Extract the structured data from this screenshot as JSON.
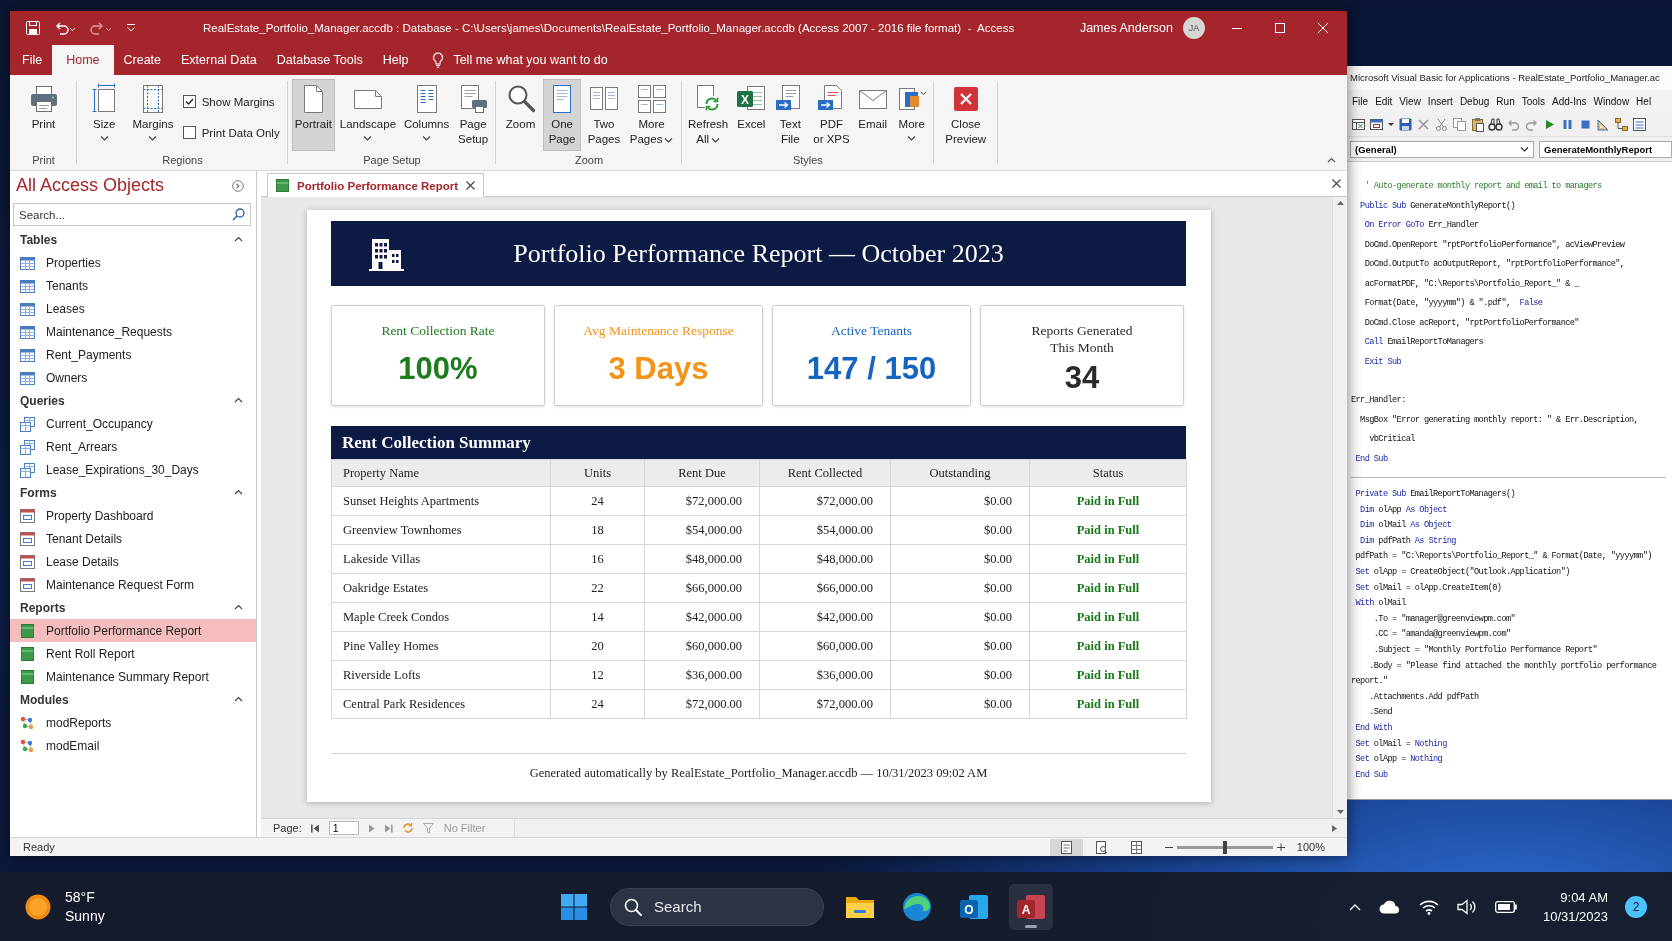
{
  "window": {
    "title": "RealEstate_Portfolio_Manager.accdb : Database - C:\\Users\\james\\Documents\\RealEstate_Portfolio_Manager.accdb (Access 2007 - 2016 file format)  -  Access",
    "user": "James Anderson",
    "initials": "JA"
  },
  "ribbon": {
    "tabs": [
      {
        "label": "File",
        "selected": false
      },
      {
        "label": "Home",
        "selected": true
      },
      {
        "label": "Create",
        "selected": false
      },
      {
        "label": "External Data",
        "selected": false
      },
      {
        "label": "Database Tools",
        "selected": false
      },
      {
        "label": "Help",
        "selected": false
      }
    ],
    "tell_me": "Tell me what you want to do",
    "groups": [
      {
        "label": "Print",
        "items": [
          {
            "kind": "large",
            "label": "Print",
            "dropdown": false,
            "selected": false
          }
        ]
      },
      {
        "label": "Regions",
        "items": [
          {
            "kind": "large",
            "label": "Size",
            "dropdown": true,
            "selected": false
          },
          {
            "kind": "large",
            "label": "Margins",
            "dropdown": true,
            "selected": false
          },
          {
            "kind": "checkbox_stack",
            "options": [
              {
                "label": "Show Margins",
                "checked": true
              },
              {
                "label": "Print Data Only",
                "checked": false
              }
            ]
          }
        ]
      },
      {
        "label": "Page Setup",
        "items": [
          {
            "kind": "large",
            "label": "Portrait",
            "dropdown": false,
            "selected": true
          },
          {
            "kind": "large",
            "label": "Landscape",
            "dropdown": true,
            "selected": false
          },
          {
            "kind": "large",
            "label": "Columns",
            "dropdown": true,
            "selected": false
          },
          {
            "kind": "large",
            "label": "Page\nSetup",
            "dropdown": false,
            "selected": false
          }
        ]
      },
      {
        "label": "Zoom",
        "items": [
          {
            "kind": "large",
            "label": "Zoom",
            "dropdown": false,
            "selected": false
          },
          {
            "kind": "large",
            "label": "One\nPage",
            "dropdown": false,
            "selected": true
          },
          {
            "kind": "large",
            "label": "Two\nPages",
            "dropdown": false,
            "selected": false
          },
          {
            "kind": "large",
            "label": "More\nPages",
            "dropdown": true,
            "selected": false
          }
        ]
      },
      {
        "label": "Styles",
        "items": [
          {
            "kind": "large",
            "label": "Refresh\nAll",
            "dropdown": true,
            "selected": false
          },
          {
            "kind": "large",
            "label": "Excel",
            "letter": "X",
            "dropdown": false,
            "selected": false
          },
          {
            "kind": "large",
            "label": "Text\nFile",
            "dropdown": false,
            "selected": false
          },
          {
            "kind": "large",
            "label": "PDF\nor XPS",
            "dropdown": false,
            "selected": false
          },
          {
            "kind": "large",
            "label": "Email",
            "dropdown": false,
            "selected": false
          },
          {
            "kind": "large",
            "label": "More",
            "dropdown": true,
            "selected": false
          }
        ]
      },
      {
        "items": [
          {
            "kind": "large",
            "label": "Close\nPreview",
            "dropdown": false,
            "selected": false
          }
        ]
      }
    ]
  },
  "nav_pane": {
    "title": "All Access Objects",
    "search": {
      "placeholder": "Search..."
    },
    "sections": [
      {
        "label": "Tables",
        "kind": "table",
        "expanded": true,
        "items": [
          {
            "label": "Properties",
            "selected": false
          },
          {
            "label": "Tenants",
            "selected": false
          },
          {
            "label": "Leases",
            "selected": false
          },
          {
            "label": "Maintenance_Requests",
            "selected": false
          },
          {
            "label": "Rent_Payments",
            "selected": false
          },
          {
            "label": "Owners",
            "selected": false
          }
        ]
      },
      {
        "label": "Queries",
        "kind": "query",
        "expanded": true,
        "items": [
          {
            "label": "Current_Occupancy",
            "selected": false
          },
          {
            "label": "Rent_Arrears",
            "selected": false
          },
          {
            "label": "Lease_Expirations_30_Days",
            "selected": false
          }
        ]
      },
      {
        "label": "Forms",
        "kind": "form",
        "expanded": true,
        "items": [
          {
            "label": "Property Dashboard",
            "selected": false
          },
          {
            "label": "Tenant Details",
            "selected": false
          },
          {
            "label": "Lease Details",
            "selected": false
          },
          {
            "label": "Maintenance Request Form",
            "selected": false
          }
        ]
      },
      {
        "label": "Reports",
        "kind": "report",
        "expanded": true,
        "items": [
          {
            "label": "Portfolio Performance Report",
            "selected": true
          },
          {
            "label": "Rent Roll Report",
            "selected": false
          },
          {
            "label": "Maintenance Summary Report",
            "selected": false
          }
        ]
      },
      {
        "label": "Modules",
        "kind": "module",
        "expanded": true,
        "items": [
          {
            "label": "modReports",
            "selected": false
          },
          {
            "label": "modEmail",
            "selected": false
          }
        ]
      }
    ]
  },
  "document_tabs": [
    {
      "label": "Portfolio Performance Report",
      "selected": true
    }
  ],
  "report": {
    "title": "Portfolio Performance Report — October 2023",
    "kpis": [
      {
        "label": "Rent Collection Rate",
        "value": "100%",
        "color": "#1e7b1e"
      },
      {
        "label": "Avg Maintenance Response",
        "value": "3 Days",
        "color": "#f39317"
      },
      {
        "label": "Active Tenants",
        "value": "147 / 150",
        "color": "#1565c0"
      },
      {
        "label": "Reports Generated\nThis Month",
        "value": "34",
        "color": "#2a2a2a"
      }
    ],
    "summary": {
      "title": "Rent Collection Summary",
      "columns": [
        "Property Name",
        "Units",
        "Rent Due",
        "Rent Collected",
        "Outstanding",
        "Status"
      ],
      "rows": [
        [
          "Sunset Heights Apartments",
          "24",
          "$72,000.00",
          "$72,000.00",
          "$0.00",
          "Paid in Full"
        ],
        [
          "Greenview Townhomes",
          "18",
          "$54,000.00",
          "$54,000.00",
          "$0.00",
          "Paid in Full"
        ],
        [
          "Lakeside Villas",
          "16",
          "$48,000.00",
          "$48,000.00",
          "$0.00",
          "Paid in Full"
        ],
        [
          "Oakridge Estates",
          "22",
          "$66,000.00",
          "$66,000.00",
          "$0.00",
          "Paid in Full"
        ],
        [
          "Maple Creek Condos",
          "14",
          "$42,000.00",
          "$42,000.00",
          "$0.00",
          "Paid in Full"
        ],
        [
          "Pine Valley Homes",
          "20",
          "$60,000.00",
          "$60,000.00",
          "$0.00",
          "Paid in Full"
        ],
        [
          "Riverside Lofts",
          "12",
          "$36,000.00",
          "$36,000.00",
          "$0.00",
          "Paid in Full"
        ],
        [
          "Central Park Residences",
          "24",
          "$72,000.00",
          "$72,000.00",
          "$0.00",
          "Paid in Full"
        ]
      ]
    },
    "footer": "Generated automatically by RealEstate_Portfolio_Manager.accdb — 10/31/2023 09:02 AM"
  },
  "record_nav": {
    "label": "Page:",
    "value": "1",
    "filter": "No Filter"
  },
  "status_bar": {
    "text": "Ready",
    "views": [
      {
        "selected": true
      },
      {
        "selected": false
      },
      {
        "selected": false
      }
    ],
    "zoom": {
      "level": 0.5
    },
    "zoom_text": "100%"
  },
  "vba": {
    "title": "Microsoft Visual Basic for Applications - RealEstate_Portfolio_Manager.ac",
    "menu": [
      "File",
      "Edit",
      "View",
      "Insert",
      "Debug",
      "Run",
      "Tools",
      "Add-Ins",
      "Window",
      "Hel"
    ],
    "object_box": "(General)",
    "procedure_box": "GenerateMonthlyReport",
    "procedures": [
      {
        "blocks": [
          {
            "lines": [
              [
                {
                  "kind": "comment",
                  "text": "   ' Auto-generate monthly report and email to managers"
                }
              ],
              [
                {
                  "kind": "keyword",
                  "text": "  Public Sub"
                },
                {
                  "kind": "plain",
                  "text": " GenerateMonthlyReport()"
                }
              ],
              [
                {
                  "kind": "keyword",
                  "text": "   On Error GoTo"
                },
                {
                  "kind": "plain",
                  "text": " Err_Handler"
                }
              ],
              [
                {
                  "kind": "plain",
                  "text": "   DoCmd.OpenReport \"rptPortfolioPerformance\", acViewPreview"
                }
              ],
              [
                {
                  "kind": "plain",
                  "text": "   DoCmd.OutputTo acOutputReport, \"rptPortfolioPerformance\","
                }
              ],
              [
                {
                  "kind": "plain",
                  "text": "   acFormatPDF, \"C:\\Reports\\Portfolio_Report_\" & _"
                }
              ],
              [
                {
                  "kind": "plain",
                  "text": "   Format(Date, \"yyyymm\") & \".pdf\","
                },
                {
                  "kind": "keyword",
                  "text": "  False"
                }
              ],
              [
                {
                  "kind": "plain",
                  "text": "   DoCmd.Close acReport, \"rptPortfolioPerformance\""
                }
              ],
              [
                {
                  "kind": "keyword",
                  "text": "   Call"
                },
                {
                  "kind": "plain",
                  "text": " EmailReportToManagers"
                }
              ],
              [
                {
                  "kind": "keyword",
                  "text": "   Exit Sub"
                }
              ]
            ]
          },
          {
            "lines": [
              [
                {
                  "kind": "plain",
                  "text": "Err_Handler:"
                }
              ],
              [
                {
                  "kind": "plain",
                  "text": "  MsgBox \"Error generating monthly report: \" & Err.Description,"
                }
              ],
              [
                {
                  "kind": "plain",
                  "text": "    vbCritical"
                }
              ],
              [
                {
                  "kind": "keyword",
                  "text": " End Sub"
                }
              ]
            ]
          }
        ]
      },
      {
        "blocks": [
          {
            "lines": [
              [
                {
                  "kind": "keyword",
                  "text": " Private Sub"
                },
                {
                  "kind": "plain",
                  "text": " EmailReportToManagers()"
                }
              ],
              [
                {
                  "kind": "keyword",
                  "text": "  Dim"
                },
                {
                  "kind": "plain",
                  "text": " olApp "
                },
                {
                  "kind": "keyword",
                  "text": "As Object"
                }
              ],
              [
                {
                  "kind": "keyword",
                  "text": "  Dim"
                },
                {
                  "kind": "plain",
                  "text": " olMail "
                },
                {
                  "kind": "keyword",
                  "text": "As Object"
                }
              ],
              [
                {
                  "kind": "keyword",
                  "text": "  Dim"
                },
                {
                  "kind": "plain",
                  "text": " pdfPath "
                },
                {
                  "kind": "keyword",
                  "text": "As String"
                }
              ],
              [
                {
                  "kind": "plain",
                  "text": " pdfPath = \"C:\\Reports\\Portfolio_Report_\" & Format(Date, \"yyyymm\")"
                }
              ],
              [
                {
                  "kind": "keyword",
                  "text": " Set"
                },
                {
                  "kind": "plain",
                  "text": " olApp = CreateObject(\"Outlook.Application\")"
                }
              ],
              [
                {
                  "kind": "keyword",
                  "text": " Set"
                },
                {
                  "kind": "plain",
                  "text": " olMail = olApp.CreateItem(0)"
                }
              ],
              [
                {
                  "kind": "keyword",
                  "text": " With"
                },
                {
                  "kind": "plain",
                  "text": " olMail"
                }
              ],
              [
                {
                  "kind": "plain",
                  "text": "     .To = \"manager@greenviewpm.com\""
                }
              ],
              [
                {
                  "kind": "plain",
                  "text": "     .CC = \"amanda@greenviewpm.com\""
                }
              ],
              [
                {
                  "kind": "plain",
                  "text": "     .Subject = \"Monthly Portfolio Performance Report\""
                }
              ],
              [
                {
                  "kind": "plain",
                  "text": "    .Body = \"Please find attached the monthly portfolio performance"
                }
              ],
              [
                {
                  "kind": "plain",
                  "text": "report.\""
                }
              ],
              [
                {
                  "kind": "plain",
                  "text": "    .Attachments.Add pdfPath"
                }
              ],
              [
                {
                  "kind": "plain",
                  "text": "    .Send"
                }
              ],
              [
                {
                  "kind": "keyword",
                  "text": " End With"
                }
              ],
              [
                {
                  "kind": "keyword",
                  "text": " Set"
                },
                {
                  "kind": "plain",
                  "text": " olMail = "
                },
                {
                  "kind": "keyword",
                  "text": "Nothing"
                }
              ],
              [
                {
                  "kind": "keyword",
                  "text": " Set"
                },
                {
                  "kind": "plain",
                  "text": " olApp = "
                },
                {
                  "kind": "keyword",
                  "text": "Nothing"
                }
              ],
              [
                {
                  "kind": "keyword",
                  "text": " End Sub"
                }
              ]
            ]
          }
        ]
      }
    ]
  },
  "taskbar": {
    "weather": {
      "temp": "58°F",
      "condition": "Sunny"
    },
    "search": {
      "placeholder": "Search"
    },
    "apps": [
      {
        "kind": "folder",
        "active": false
      },
      {
        "kind": "browser",
        "active": false
      },
      {
        "kind": "mail",
        "letter": "O",
        "active": false
      },
      {
        "kind": "database",
        "letter": "A",
        "active": true
      }
    ],
    "clock": {
      "time": "9:04 AM",
      "date": "10/31/2023"
    },
    "notifications": "2"
  }
}
